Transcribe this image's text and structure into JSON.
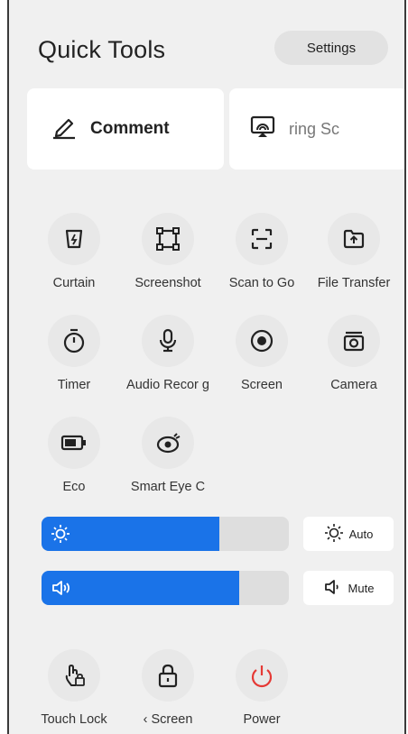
{
  "header": {
    "title": "Quick Tools",
    "settings_label": "Settings"
  },
  "cards": {
    "comment_label": "Comment",
    "share_label": "ring Sc"
  },
  "tools": [
    {
      "label": "Curtain",
      "icon": "curtain-icon"
    },
    {
      "label": "Screenshot",
      "icon": "screenshot-icon"
    },
    {
      "label": "Scan to Go",
      "icon": "scan-icon"
    },
    {
      "label": "File Transfer",
      "icon": "file-transfer-icon"
    },
    {
      "label": "Timer",
      "icon": "timer-icon"
    },
    {
      "label": "Audio Recor g",
      "icon": "microphone-icon"
    },
    {
      "label": "Screen",
      "icon": "screen-record-icon"
    },
    {
      "label": "Camera",
      "icon": "camera-icon"
    },
    {
      "label": "Eco",
      "icon": "battery-icon"
    },
    {
      "label": "Smart Eye C",
      "icon": "eye-icon"
    }
  ],
  "brightness": {
    "level": 0.72,
    "auto_label": "Auto"
  },
  "volume": {
    "level": 0.8,
    "mute_label": "Mute"
  },
  "bottom": [
    {
      "label": "Touch Lock",
      "icon": "touch-lock-icon"
    },
    {
      "label": "‹ Screen",
      "icon": "lock-icon"
    },
    {
      "label": "Power",
      "icon": "power-icon"
    }
  ],
  "colors": {
    "accent": "#1a73e8",
    "power": "#e53935",
    "panel_bg": "#f0f0f0"
  }
}
